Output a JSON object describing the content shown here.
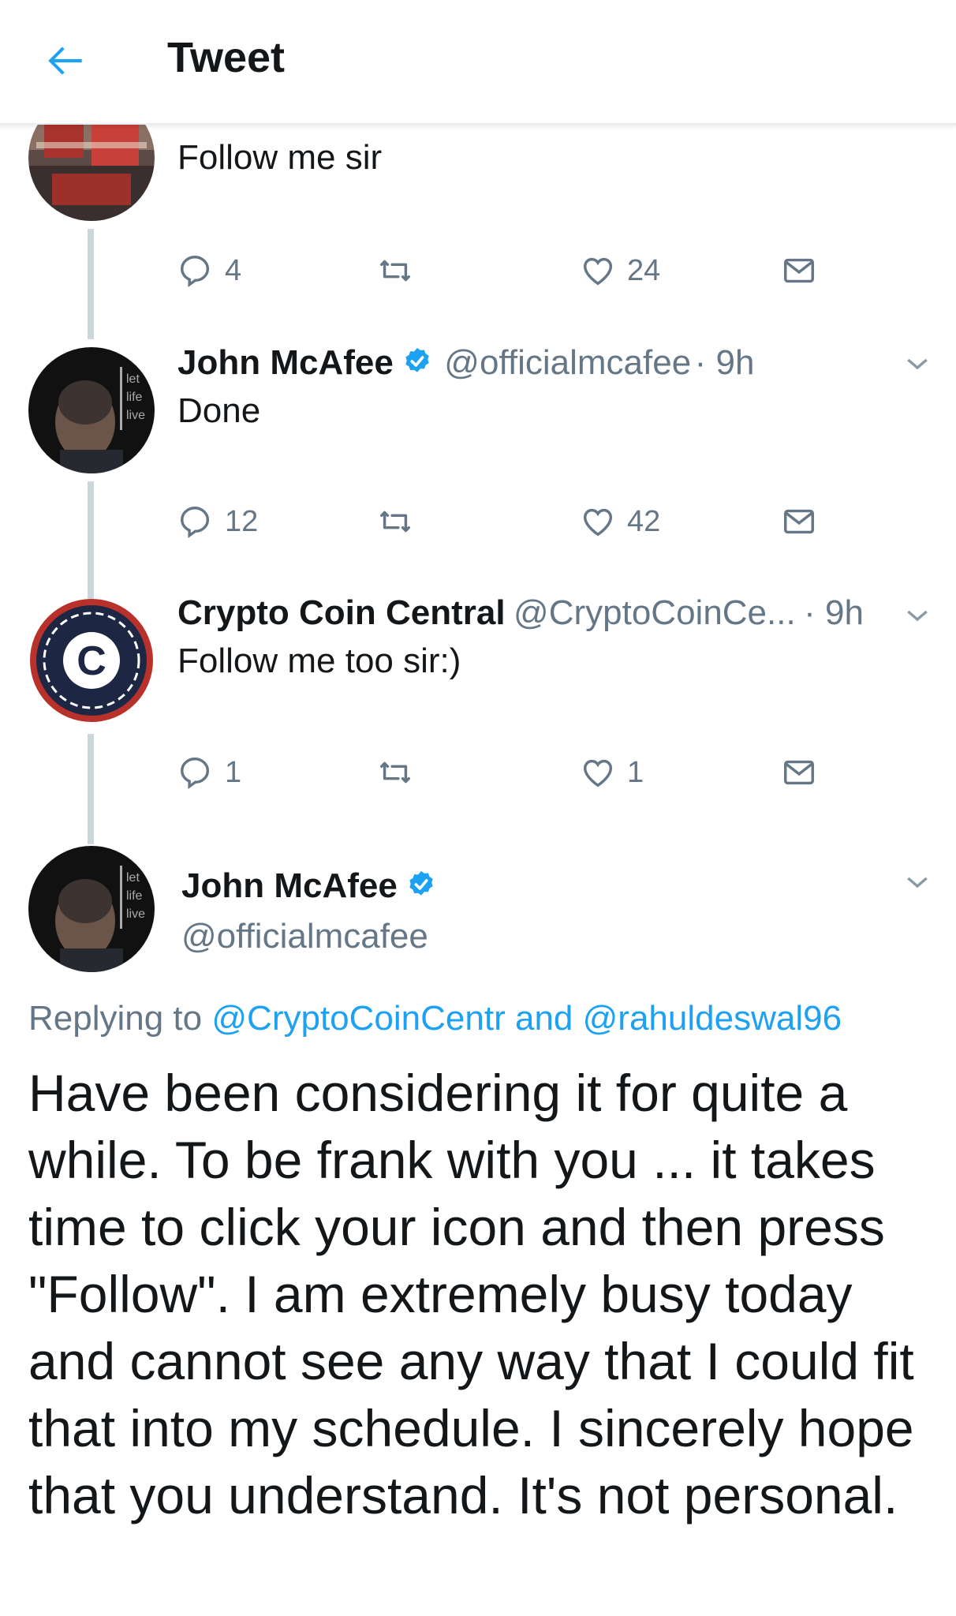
{
  "header": {
    "title": "Tweet",
    "back_icon": "arrow-left-icon"
  },
  "colors": {
    "accent": "#1da1f2",
    "secondary_text": "#657786",
    "thread_line": "#ccd6dd"
  },
  "tweets": [
    {
      "text": "Follow me sir",
      "avatar": "street-photo-avatar",
      "reply_count": "4",
      "like_count": "24"
    },
    {
      "name": "John McAfee",
      "handle": "@officialmcafee",
      "time": "· 9h",
      "text": "Done",
      "avatar_text": [
        "let",
        "life",
        "live"
      ],
      "reply_count": "12",
      "like_count": "42"
    },
    {
      "name": "Crypto Coin Central",
      "handle": "@CryptoCoinCe...",
      "time": "· 9h",
      "text": "Follow me too sir:)",
      "avatar_letter": "C",
      "reply_count": "1",
      "like_count": "1"
    }
  ],
  "main_tweet": {
    "name": "John McAfee",
    "handle": "@officialmcafee",
    "avatar_text": [
      "let",
      "life",
      "live"
    ],
    "replying_prefix": "Replying to",
    "mention_1": "@CryptoCoinCentr",
    "conjunction": "and",
    "mention_2": "@rahuldeswal96",
    "text": "Have been considering it for quite a while. To be frank with you ... it takes time to click your icon and then press \"Follow\". I am extremely busy today and cannot see any way that I could fit that into my schedule. I sincerely hope that you understand. It's not personal."
  }
}
